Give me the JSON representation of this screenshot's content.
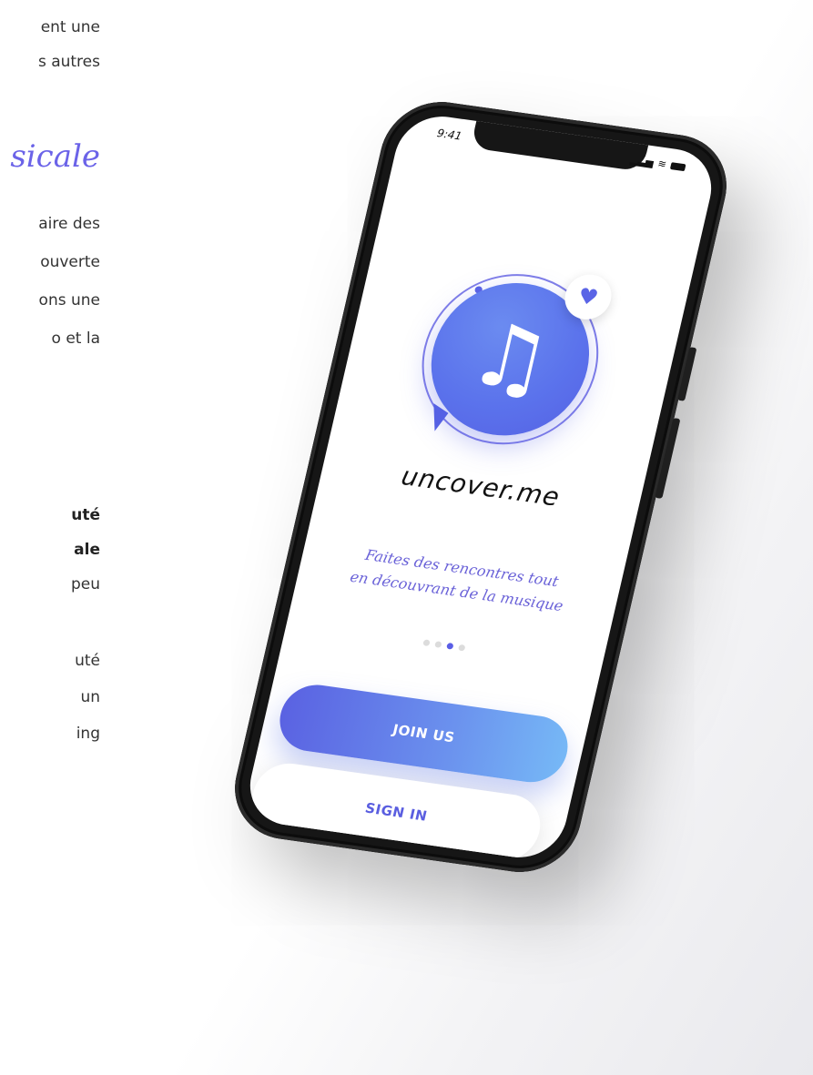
{
  "article": {
    "line1": "ent une",
    "line2": "s autres",
    "heading": "sicale",
    "p1": "aire des",
    "p2": "ouverte",
    "p3": "ons une",
    "p4": "o et la",
    "b1": "uté",
    "b2": "ale",
    "b3": "peu",
    "b4": "uté",
    "b5": "un",
    "b6": "ing"
  },
  "phone": {
    "status_time": "9:41",
    "status_signal": "▂▃▅",
    "status_wifi": "≋",
    "brand": "uncover.me",
    "tagline_line1": "Faites des rencontres tout",
    "tagline_line2": "en découvrant de la musique",
    "dots": 4,
    "active_dot": 2,
    "join_label": "JOIN US",
    "signin_label": "SIGN IN"
  },
  "icons": {
    "logo": "music-note-icon",
    "badge": "heart-icon"
  },
  "colors": {
    "accent": "#5a62e2",
    "gradient_end": "#76b8f6",
    "tagline": "#6a62d8",
    "heading": "#6b63e8"
  }
}
